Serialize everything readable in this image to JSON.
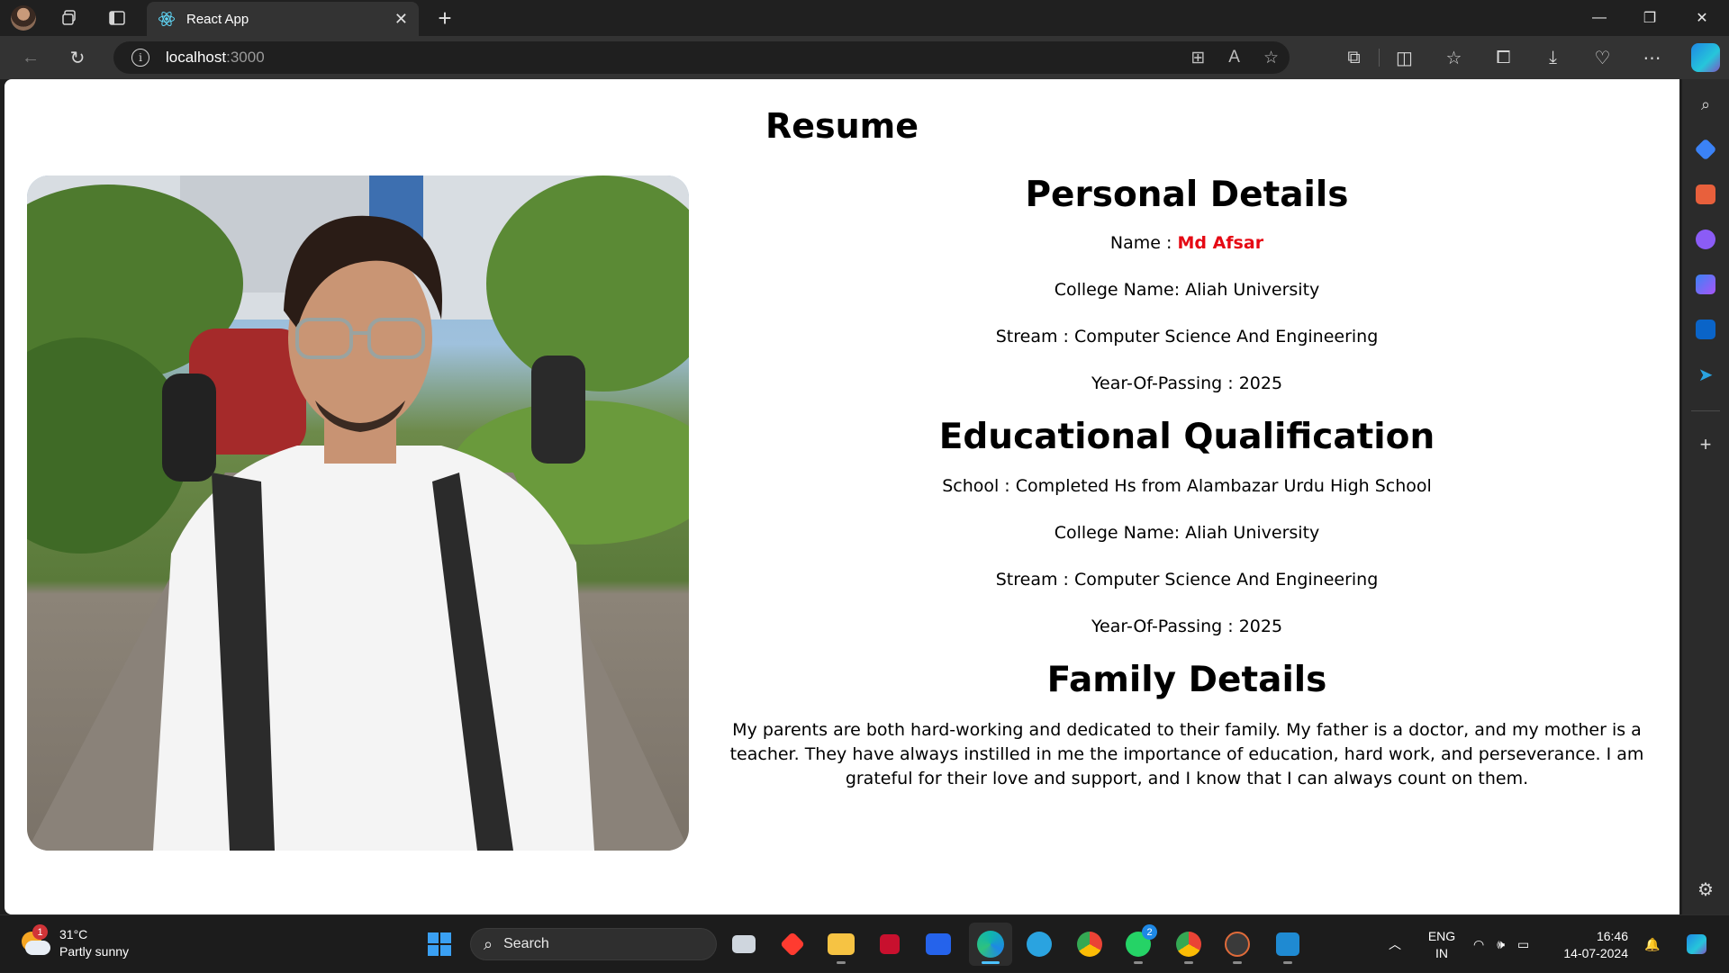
{
  "browser": {
    "tab_title": "React App",
    "url_host": "localhost",
    "url_port": ":3000"
  },
  "page": {
    "title": "Resume",
    "personal": {
      "heading": "Personal Details",
      "name_label": "Name : ",
      "name_value": "Md Afsar",
      "college": "College Name: Aliah University",
      "stream": "Stream : Computer Science And Engineering",
      "year": "Year-Of-Passing : 2025"
    },
    "education": {
      "heading": "Educational Qualification",
      "school": "School : Completed Hs from Alambazar Urdu High School",
      "college": "College Name: Aliah University",
      "stream": "Stream : Computer Science And Engineering",
      "year": "Year-Of-Passing : 2025"
    },
    "family": {
      "heading": "Family Details",
      "text": "My parents are both hard-working and dedicated to their family. My father is a doctor, and my mother is a teacher. They have always instilled in me the importance of education, hard work, and perseverance. I am grateful for their love and support, and I know that I can always count on them."
    }
  },
  "taskbar": {
    "weather_temp": "31°C",
    "weather_desc": "Partly sunny",
    "weather_badge": "1",
    "search_label": "Search",
    "whatsapp_badge": "2",
    "lang_line1": "ENG",
    "lang_line2": "IN",
    "time": "16:46",
    "date": "14-07-2024"
  },
  "colors": {
    "name_accent": "#e50914",
    "edge_blue": "#0078d4",
    "taskbar_bg": "#1c1c1c"
  }
}
